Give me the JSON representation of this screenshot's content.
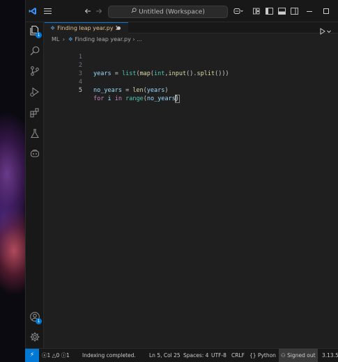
{
  "titlebar": {
    "search_text": "Untitled (Workspace)"
  },
  "activity_bar": {
    "explorer_badge": "1",
    "accounts_badge": "1"
  },
  "tab": {
    "label": "Finding leap year.py 1"
  },
  "breadcrumb": {
    "root": "ML",
    "separator": "›",
    "file": "Finding leap year.py",
    "tail": "› ..."
  },
  "editor": {
    "line_numbers": [
      "1",
      "2",
      "3",
      "4",
      "5"
    ],
    "line2": {
      "v1": "years",
      "op1": " = ",
      "f1": "list",
      "p1": "(",
      "f2": "map",
      "p2": "(",
      "t1": "int",
      "c1": ",",
      "f3": "input",
      "p3": "().",
      "f4": "split",
      "p4": "()))"
    },
    "line4": {
      "v1": "no_years",
      "op1": " = ",
      "f1": "len",
      "p1": "(",
      "v2": "years",
      "p2": ")"
    },
    "line5": {
      "k1": "for",
      "s1": " ",
      "v1": "i",
      "s2": " ",
      "k2": "in",
      "s3": " ",
      "f1": "range",
      "p1": "(",
      "v2": "no_years",
      "p2": ")"
    }
  },
  "status_bar": {
    "errors": "1",
    "warnings": "0",
    "infos": "1",
    "indexing": "Indexing completed.",
    "position": "Ln 5, Col 25",
    "spaces": "Spaces: 4",
    "encoding": "UTF-8",
    "eol": "CRLF",
    "language": "Python",
    "signed_out": "Signed out",
    "version": "3.13.5"
  },
  "colors": {
    "accent": "#0078d4",
    "tab_modified": "#e2c08d"
  }
}
